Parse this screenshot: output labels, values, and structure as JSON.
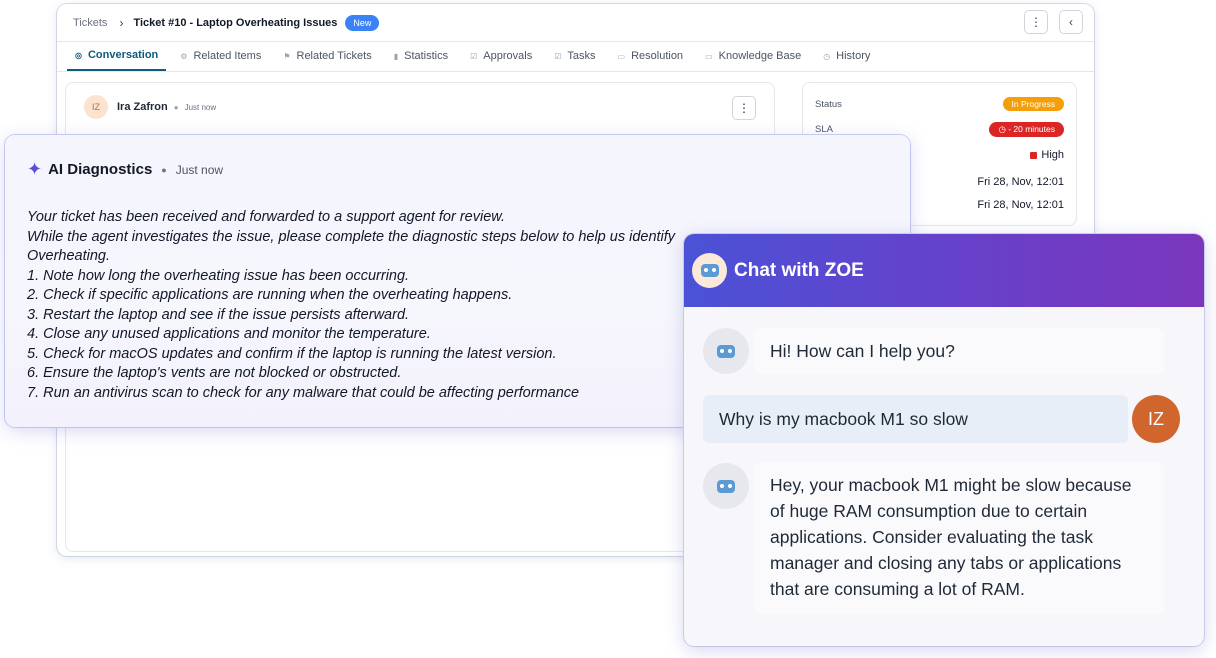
{
  "header": {
    "breadcrumb_root": "Tickets",
    "breadcrumb_sep": "›",
    "ticket_title": "Ticket #10 - Laptop Overheating Issues",
    "status_badge": "New",
    "more_icon": "⋮",
    "collapse_icon": "‹"
  },
  "tabs": [
    {
      "label": "Conversation",
      "icon": "chat-icon",
      "glyph": "◎"
    },
    {
      "label": "Related Items",
      "icon": "items-icon",
      "glyph": "⚙"
    },
    {
      "label": "Related Tickets",
      "icon": "tickets-icon",
      "glyph": "⚑"
    },
    {
      "label": "Statistics",
      "icon": "stats-icon",
      "glyph": "▮"
    },
    {
      "label": "Approvals",
      "icon": "approvals-icon",
      "glyph": "☑"
    },
    {
      "label": "Tasks",
      "icon": "tasks-icon",
      "glyph": "☑"
    },
    {
      "label": "Resolution",
      "icon": "resolution-icon",
      "glyph": "▭"
    },
    {
      "label": "Knowledge Base",
      "icon": "book-icon",
      "glyph": "▭"
    },
    {
      "label": "History",
      "icon": "history-icon",
      "glyph": "◷"
    }
  ],
  "conversation": {
    "author_initials": "IZ",
    "author_name": "Ira Zafron",
    "time": "Just now",
    "more_icon": "⋮"
  },
  "details": {
    "status_label": "Status",
    "status_value": "In Progress",
    "sla_label": "SLA",
    "sla_value": "◷ - 20 minutes",
    "priority_value": "High",
    "date_1": "Fri 28, Nov, 12:01",
    "date_2": "Fri 28, Nov, 12:01"
  },
  "ai": {
    "title": "AI Diagnostics",
    "time": "Just now",
    "icon": "sparkle-icon",
    "lines": [
      "Your ticket has been received and forwarded to a support agent for review.",
      "While the agent investigates the issue, please complete the diagnostic steps below to help us identify",
      "Overheating.",
      "1. Note how long the overheating issue has been occurring.",
      "2. Check if specific applications are running when the overheating happens.",
      "3. Restart the laptop and see if the issue persists afterward.",
      "4. Close any unused applications and monitor the temperature.",
      "5. Check for macOS updates and confirm if the laptop is running the latest version.",
      "6. Ensure the laptop's vents are not blocked or obstructed.",
      "7. Run an antivirus scan to check for any malware that could be affecting performance"
    ]
  },
  "chat": {
    "title": "Chat with ZOE",
    "bot_greeting": "Hi! How can I help you?",
    "user_message": "Why is my macbook M1 so slow",
    "user_initials": "IZ",
    "bot_reply": "Hey, your macbook M1 might be slow because of huge RAM consumption due to certain applications. Consider evaluating the task manager and closing any tabs or applications that are consuming a lot of RAM.",
    "colors": {
      "header_start": "#4b52d6",
      "header_end": "#7b36bd",
      "user_avatar": "#d0652e"
    }
  }
}
